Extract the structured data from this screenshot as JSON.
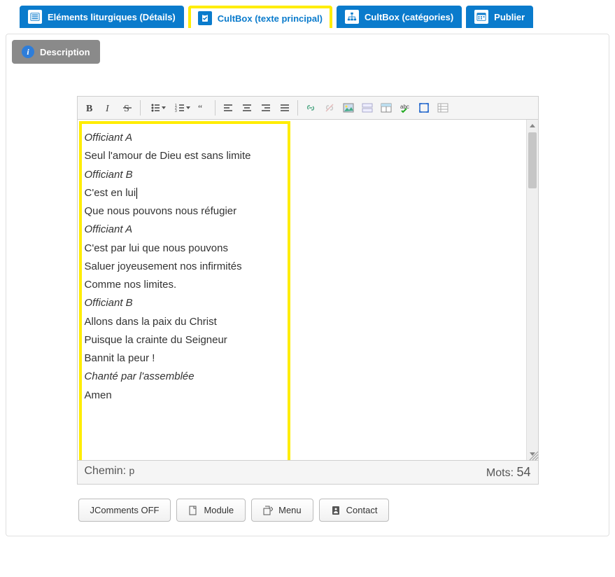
{
  "tabs": [
    {
      "label": "Eléments liturgiques (Détails)",
      "active": false
    },
    {
      "label": "CultBox (texte principal)",
      "active": true
    },
    {
      "label": "CultBox (catégories)",
      "active": false
    },
    {
      "label": "Publier",
      "active": false
    }
  ],
  "description_btn": "Description",
  "editor": {
    "lines": [
      {
        "text": "Officiant A",
        "italic": true
      },
      {
        "text": "Seul l'amour de Dieu est sans limite",
        "italic": false
      },
      {
        "text": "Officiant B",
        "italic": true
      },
      {
        "text": "C'est en lui",
        "italic": false,
        "cursor": true
      },
      {
        "text": "Que nous pouvons nous réfugier",
        "italic": false
      },
      {
        "text": "Officiant A",
        "italic": true
      },
      {
        "text": "C'est par lui que nous pouvons",
        "italic": false
      },
      {
        "text": "Saluer joyeusement nos infirmités",
        "italic": false
      },
      {
        "text": "Comme nos limites.",
        "italic": false
      },
      {
        "text": "Officiant B",
        "italic": true
      },
      {
        "text": "Allons dans la paix du Christ",
        "italic": false
      },
      {
        "text": "Puisque la crainte du Seigneur",
        "italic": false
      },
      {
        "text": "Bannit la peur !",
        "italic": false
      },
      {
        "text": "Chanté par l'assemblée",
        "italic": true
      },
      {
        "text": "Amen",
        "italic": false
      }
    ],
    "path_label": "Chemin:",
    "path_value": "p",
    "words_label": "Mots:",
    "words_value": "54"
  },
  "buttons": {
    "jcomments": "JComments OFF",
    "module": "Module",
    "menu": "Menu",
    "contact": "Contact"
  }
}
